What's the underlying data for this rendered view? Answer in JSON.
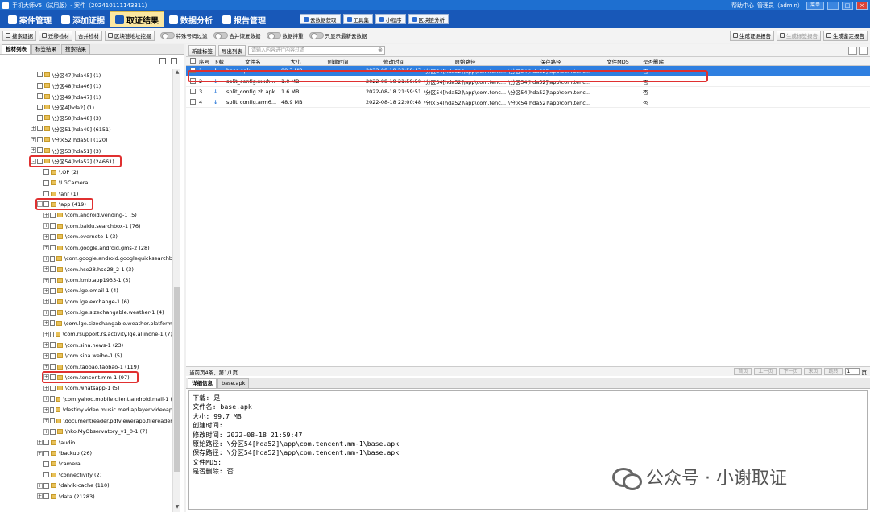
{
  "window": {
    "title": "手机大师V5（试用版）- 案件（202410111143311）",
    "help": "帮助中心",
    "user": "管理员（admin）",
    "menu_btn": "菜单"
  },
  "menubar": {
    "items": [
      "案件管理",
      "添加证据",
      "取证结果",
      "数据分析",
      "报告管理"
    ],
    "active_index": 2,
    "quick": [
      "云数据获取",
      "工具集",
      "小程序",
      "区块链分析"
    ]
  },
  "toolbar": {
    "buttons": [
      "搜索证据",
      "迁移检材",
      "合并检材",
      "区块链地址挖掘"
    ],
    "toggles": [
      "特殊号码过滤",
      "合并恢复数据",
      "数据排重",
      "只显示最新云数据"
    ],
    "right": [
      "生成证据报告",
      "生成标签报告",
      "生成鉴定报告"
    ]
  },
  "left": {
    "tabs": [
      "检材列表",
      "标签结果",
      "搜索结果"
    ],
    "tree": [
      {
        "label": "\\分区47[hda45] (1)",
        "indent": 1,
        "exp": false,
        "hl": false
      },
      {
        "label": "\\分区48[hda46] (1)",
        "indent": 1,
        "exp": false,
        "hl": false
      },
      {
        "label": "\\分区49[hda47] (1)",
        "indent": 1,
        "exp": false,
        "hl": false
      },
      {
        "label": "\\分区4[hda2] (1)",
        "indent": 1,
        "exp": false,
        "hl": false
      },
      {
        "label": "\\分区50[hda48] (3)",
        "indent": 1,
        "exp": false,
        "hl": false
      },
      {
        "label": "\\分区51[hda49] (6151)",
        "indent": 1,
        "exp": true,
        "sign": "+",
        "hl": false
      },
      {
        "label": "\\分区52[hda50] (120)",
        "indent": 1,
        "exp": true,
        "sign": "+",
        "hl": false
      },
      {
        "label": "\\分区53[hda51] (3)",
        "indent": 1,
        "exp": true,
        "sign": "+",
        "hl": false
      },
      {
        "label": "\\分区54[hda52] (24661)",
        "indent": 1,
        "exp": true,
        "sign": "-",
        "hl": true
      },
      {
        "label": "\\.OP (2)",
        "indent": 2,
        "exp": false,
        "hl": false
      },
      {
        "label": "\\LGCamera",
        "indent": 2,
        "exp": false,
        "hl": false
      },
      {
        "label": "\\anr (1)",
        "indent": 2,
        "exp": false,
        "hl": false
      },
      {
        "label": "\\app (419)",
        "indent": 2,
        "exp": true,
        "sign": "-",
        "hl": true
      },
      {
        "label": "\\com.android.vending-1 (5)",
        "indent": 3,
        "exp": true,
        "sign": "+",
        "hl": false
      },
      {
        "label": "\\com.baidu.searchbox-1 (76)",
        "indent": 3,
        "exp": true,
        "sign": "+",
        "hl": false
      },
      {
        "label": "\\com.evernote-1 (3)",
        "indent": 3,
        "exp": true,
        "sign": "+",
        "hl": false
      },
      {
        "label": "\\com.google.android.gms-2 (28)",
        "indent": 3,
        "exp": true,
        "sign": "+",
        "hl": false
      },
      {
        "label": "\\com.google.android.googlequicksearchb",
        "indent": 3,
        "exp": true,
        "sign": "+",
        "hl": false
      },
      {
        "label": "\\com.hse28.hse28_2-1 (3)",
        "indent": 3,
        "exp": true,
        "sign": "+",
        "hl": false
      },
      {
        "label": "\\com.kmb.app1933-1 (3)",
        "indent": 3,
        "exp": true,
        "sign": "+",
        "hl": false
      },
      {
        "label": "\\com.lge.email-1 (4)",
        "indent": 3,
        "exp": true,
        "sign": "+",
        "hl": false
      },
      {
        "label": "\\com.lge.exchange-1 (6)",
        "indent": 3,
        "exp": true,
        "sign": "+",
        "hl": false
      },
      {
        "label": "\\com.lge.sizechangable.weather-1 (4)",
        "indent": 3,
        "exp": true,
        "sign": "+",
        "hl": false
      },
      {
        "label": "\\com.lge.sizechangable.weather.platform",
        "indent": 3,
        "exp": true,
        "sign": "+",
        "hl": false
      },
      {
        "label": "\\com.rsupport.rs.activity.lge.allinone-1 (7)",
        "indent": 3,
        "exp": true,
        "sign": "+",
        "hl": false
      },
      {
        "label": "\\com.sina.news-1 (23)",
        "indent": 3,
        "exp": true,
        "sign": "+",
        "hl": false
      },
      {
        "label": "\\com.sina.weibo-1 (5)",
        "indent": 3,
        "exp": true,
        "sign": "+",
        "hl": false
      },
      {
        "label": "\\com.taobao.taobao-1 (119)",
        "indent": 3,
        "exp": true,
        "sign": "+",
        "hl": false
      },
      {
        "label": "\\com.tencent.mm-1 (97)",
        "indent": 3,
        "exp": true,
        "sign": "+",
        "hl": true
      },
      {
        "label": "\\com.whatsapp-1 (5)",
        "indent": 3,
        "exp": true,
        "sign": "+",
        "hl": false
      },
      {
        "label": "\\com.yahoo.mobile.client.android.mail-1 (",
        "indent": 3,
        "exp": true,
        "sign": "+",
        "hl": false
      },
      {
        "label": "\\destiny.video.music.mediaplayer.videoap",
        "indent": 3,
        "exp": true,
        "sign": "+",
        "hl": false
      },
      {
        "label": "\\documentreader.pdfviewerapp.filereader",
        "indent": 3,
        "exp": true,
        "sign": "+",
        "hl": false
      },
      {
        "label": "\\hko.MyObservatory_v1_0-1 (7)",
        "indent": 3,
        "exp": true,
        "sign": "+",
        "hl": false
      },
      {
        "label": "\\audio",
        "indent": 2,
        "exp": true,
        "sign": "+",
        "hl": false
      },
      {
        "label": "\\backup (26)",
        "indent": 2,
        "exp": true,
        "sign": "+",
        "hl": false
      },
      {
        "label": "\\camera",
        "indent": 2,
        "exp": false,
        "hl": false
      },
      {
        "label": "\\connectivity (2)",
        "indent": 2,
        "exp": false,
        "hl": false
      },
      {
        "label": "\\dalvik-cache (110)",
        "indent": 2,
        "exp": true,
        "sign": "+",
        "hl": false
      },
      {
        "label": "\\data (21283)",
        "indent": 2,
        "exp": true,
        "sign": "+",
        "hl": false
      }
    ]
  },
  "main": {
    "new_tag": "新建标签",
    "export": "导出列表",
    "filter_placeholder": "请输入内容进行内容过滤",
    "columns": [
      "序号",
      "下载",
      "文件名",
      "大小",
      "创建时间",
      "修改时间",
      "原始路径",
      "保存路径",
      "文件MD5",
      "是否删除"
    ],
    "rows": [
      {
        "no": "1",
        "name": "base.apk",
        "size": "99.7 MB",
        "ctime": "",
        "mtime": "2022-08-18 21:59:47",
        "orig": "\\分区54[hda52]\\app\\com.tenc...",
        "save": "\\分区54[hda52]\\app\\com.tenc...",
        "md5": "",
        "del": "否"
      },
      {
        "no": "2",
        "name": "split_config.xxxh...",
        "size": "1.0 MB",
        "ctime": "",
        "mtime": "2022-08-18 21:59:50",
        "orig": "\\分区54[hda52]\\app\\com.tenc...",
        "save": "\\分区54[hda52]\\app\\com.tenc...",
        "md5": "",
        "del": "否"
      },
      {
        "no": "3",
        "name": "split_config.zh.apk",
        "size": "1.6 MB",
        "ctime": "",
        "mtime": "2022-08-18 21:59:51",
        "orig": "\\分区54[hda52]\\app\\com.tenc...",
        "save": "\\分区54[hda52]\\app\\com.tenc...",
        "md5": "",
        "del": "否"
      },
      {
        "no": "4",
        "name": "split_config.arm6...",
        "size": "48.9 MB",
        "ctime": "",
        "mtime": "2022-08-18 22:00:48",
        "orig": "\\分区54[hda52]\\app\\com.tenc...",
        "save": "\\分区54[hda52]\\app\\com.tenc...",
        "md5": "",
        "del": "否"
      }
    ],
    "selected_row": 0,
    "pager_info": "当前页4条，第1/1页",
    "pager_btns": [
      "首页",
      "上一页",
      "下一页",
      "末页"
    ],
    "goto": "跳转",
    "goto_val": "1",
    "page_unit": "页"
  },
  "detail": {
    "tabs": [
      "详细信息",
      "base.apk"
    ],
    "lines": [
      "下载: 是",
      "文件名: base.apk",
      "大小: 99.7 MB",
      "创建时间:",
      "修改时间: 2022-08-18 21:59:47",
      "原始路径: \\分区54[hda52]\\app\\com.tencent.mm-1\\base.apk",
      "保存路径: \\分区54[hda52]\\app\\com.tencent.mm-1\\base.apk",
      "文件MD5:",
      "是否删除: 否"
    ]
  },
  "watermark": "公众号 · 小谢取证"
}
